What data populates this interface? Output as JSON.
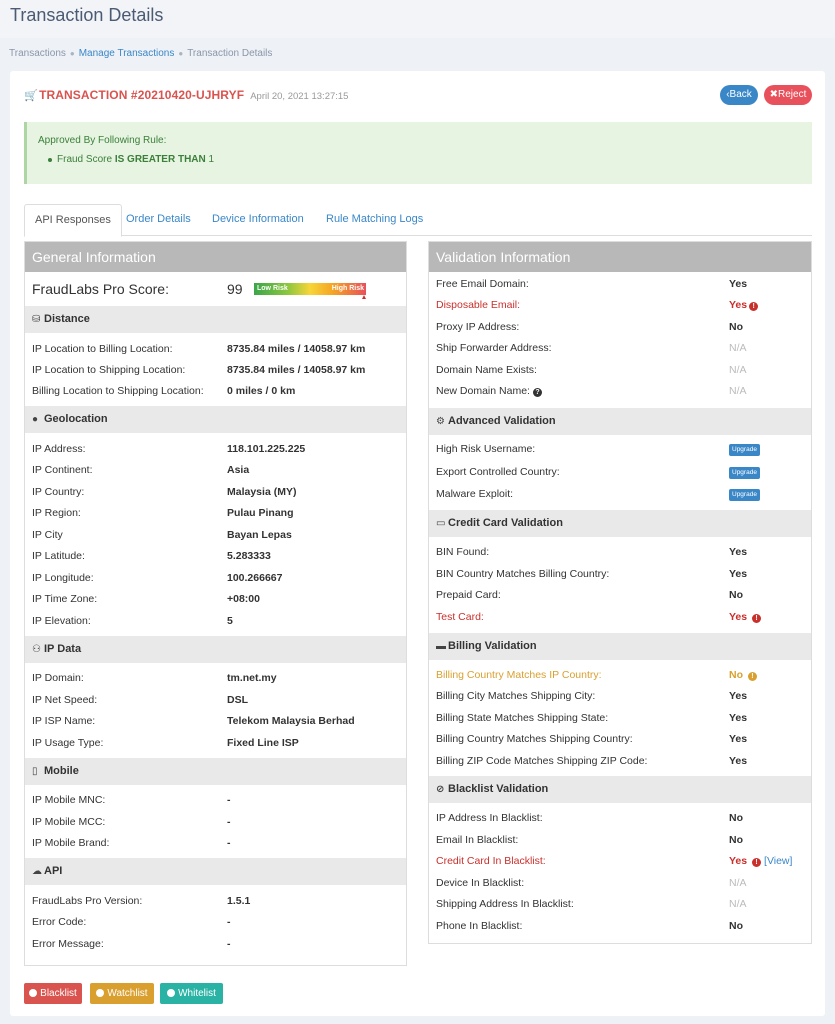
{
  "header": {
    "title": "Transaction Details"
  },
  "breadcrumb": {
    "items": [
      "Transactions",
      "Manage Transactions",
      "Transaction Details"
    ]
  },
  "transaction": {
    "id": "TRANSACTION #20210420-UJHRYF",
    "date": "April 20, 2021 13:27:15"
  },
  "actions": {
    "back": "Back",
    "reject": "Reject"
  },
  "approval": {
    "title": "Approved By Following Rule:",
    "rule_field": "Fraud Score",
    "rule_op": "IS GREATER THAN",
    "rule_value": "1"
  },
  "tabs": [
    "API Responses",
    "Order Details",
    "Device Information",
    "Rule Matching Logs"
  ],
  "general": {
    "title": "General Information",
    "score_label": "FraudLabs Pro Score:",
    "score_value": "99",
    "risk_low": "Low Risk",
    "risk_high": "High Risk",
    "sections": {
      "distance": "Distance",
      "geolocation": "Geolocation",
      "ip_data": "IP Data",
      "mobile": "Mobile",
      "api": "API"
    },
    "distance": [
      {
        "label": "IP Location to Billing Location:",
        "value": "8735.84 miles / 14058.97 km"
      },
      {
        "label": "IP Location to Shipping Location:",
        "value": "8735.84 miles / 14058.97 km"
      },
      {
        "label": "Billing Location to Shipping Location:",
        "value": "0 miles / 0 km"
      }
    ],
    "geolocation": [
      {
        "label": "IP Address:",
        "value": "118.101.225.225"
      },
      {
        "label": "IP Continent:",
        "value": "Asia"
      },
      {
        "label": "IP Country:",
        "value": "Malaysia (MY)"
      },
      {
        "label": "IP Region:",
        "value": "Pulau Pinang"
      },
      {
        "label": "IP City",
        "value": "Bayan Lepas"
      },
      {
        "label": "IP Latitude:",
        "value": "5.283333"
      },
      {
        "label": "IP Longitude:",
        "value": "100.266667"
      },
      {
        "label": "IP Time Zone:",
        "value": "+08:00"
      },
      {
        "label": "IP Elevation:",
        "value": "5"
      }
    ],
    "ip_data": [
      {
        "label": "IP Domain:",
        "value": "tm.net.my"
      },
      {
        "label": "IP Net Speed:",
        "value": "DSL"
      },
      {
        "label": "IP ISP Name:",
        "value": "Telekom Malaysia Berhad"
      },
      {
        "label": "IP Usage Type:",
        "value": "Fixed Line ISP"
      }
    ],
    "mobile": [
      {
        "label": "IP Mobile MNC:",
        "value": "-"
      },
      {
        "label": "IP Mobile MCC:",
        "value": "-"
      },
      {
        "label": "IP Mobile Brand:",
        "value": "-"
      }
    ],
    "api": [
      {
        "label": "FraudLabs Pro Version:",
        "value": "1.5.1"
      },
      {
        "label": "Error Code:",
        "value": "-"
      },
      {
        "label": "Error Message:",
        "value": "-"
      }
    ]
  },
  "validation": {
    "title": "Validation Information",
    "sections": {
      "advanced": "Advanced Validation",
      "credit_card": "Credit Card Validation",
      "billing": "Billing Validation",
      "blacklist": "Blacklist Validation"
    },
    "basic": [
      {
        "label": "Free Email Domain:",
        "value": "Yes"
      },
      {
        "label": "Disposable Email:",
        "value": "Yes"
      },
      {
        "label": "Proxy IP Address:",
        "value": "No"
      },
      {
        "label": "Ship Forwarder Address:",
        "value": "N/A"
      },
      {
        "label": "Domain Name Exists:",
        "value": "N/A"
      },
      {
        "label": "New Domain Name:",
        "value": "N/A"
      }
    ],
    "advanced": [
      {
        "label": "High Risk Username:",
        "value": "Upgrade"
      },
      {
        "label": "Export Controlled Country:",
        "value": "Upgrade"
      },
      {
        "label": "Malware Exploit:",
        "value": "Upgrade"
      }
    ],
    "credit_card": [
      {
        "label": "BIN Found:",
        "value": "Yes"
      },
      {
        "label": "BIN Country Matches Billing Country:",
        "value": "Yes"
      },
      {
        "label": "Prepaid Card:",
        "value": "No"
      },
      {
        "label": "Test Card:",
        "value": "Yes"
      }
    ],
    "billing": [
      {
        "label": "Billing Country Matches IP Country:",
        "value": "No"
      },
      {
        "label": "Billing City Matches Shipping City:",
        "value": "Yes"
      },
      {
        "label": "Billing State Matches Shipping State:",
        "value": "Yes"
      },
      {
        "label": "Billing Country Matches Shipping Country:",
        "value": "Yes"
      },
      {
        "label": "Billing ZIP Code Matches Shipping ZIP Code:",
        "value": "Yes"
      }
    ],
    "blacklist": [
      {
        "label": "IP Address In Blacklist:",
        "value": "No"
      },
      {
        "label": "Email In Blacklist:",
        "value": "No"
      },
      {
        "label": "Credit Card In Blacklist:",
        "value": "Yes",
        "link": "[View]"
      },
      {
        "label": "Device In Blacklist:",
        "value": "N/A"
      },
      {
        "label": "Shipping Address In Blacklist:",
        "value": "N/A"
      },
      {
        "label": "Phone In Blacklist:",
        "value": "No"
      }
    ]
  },
  "footer_buttons": {
    "blacklist": "Blacklist",
    "watchlist": "Watchlist",
    "whitelist": "Whitelist"
  },
  "colors": {
    "accent": "#3a87c8",
    "danger": "#d9534f",
    "warning": "#d9a030",
    "success": "#2ab3a4"
  }
}
